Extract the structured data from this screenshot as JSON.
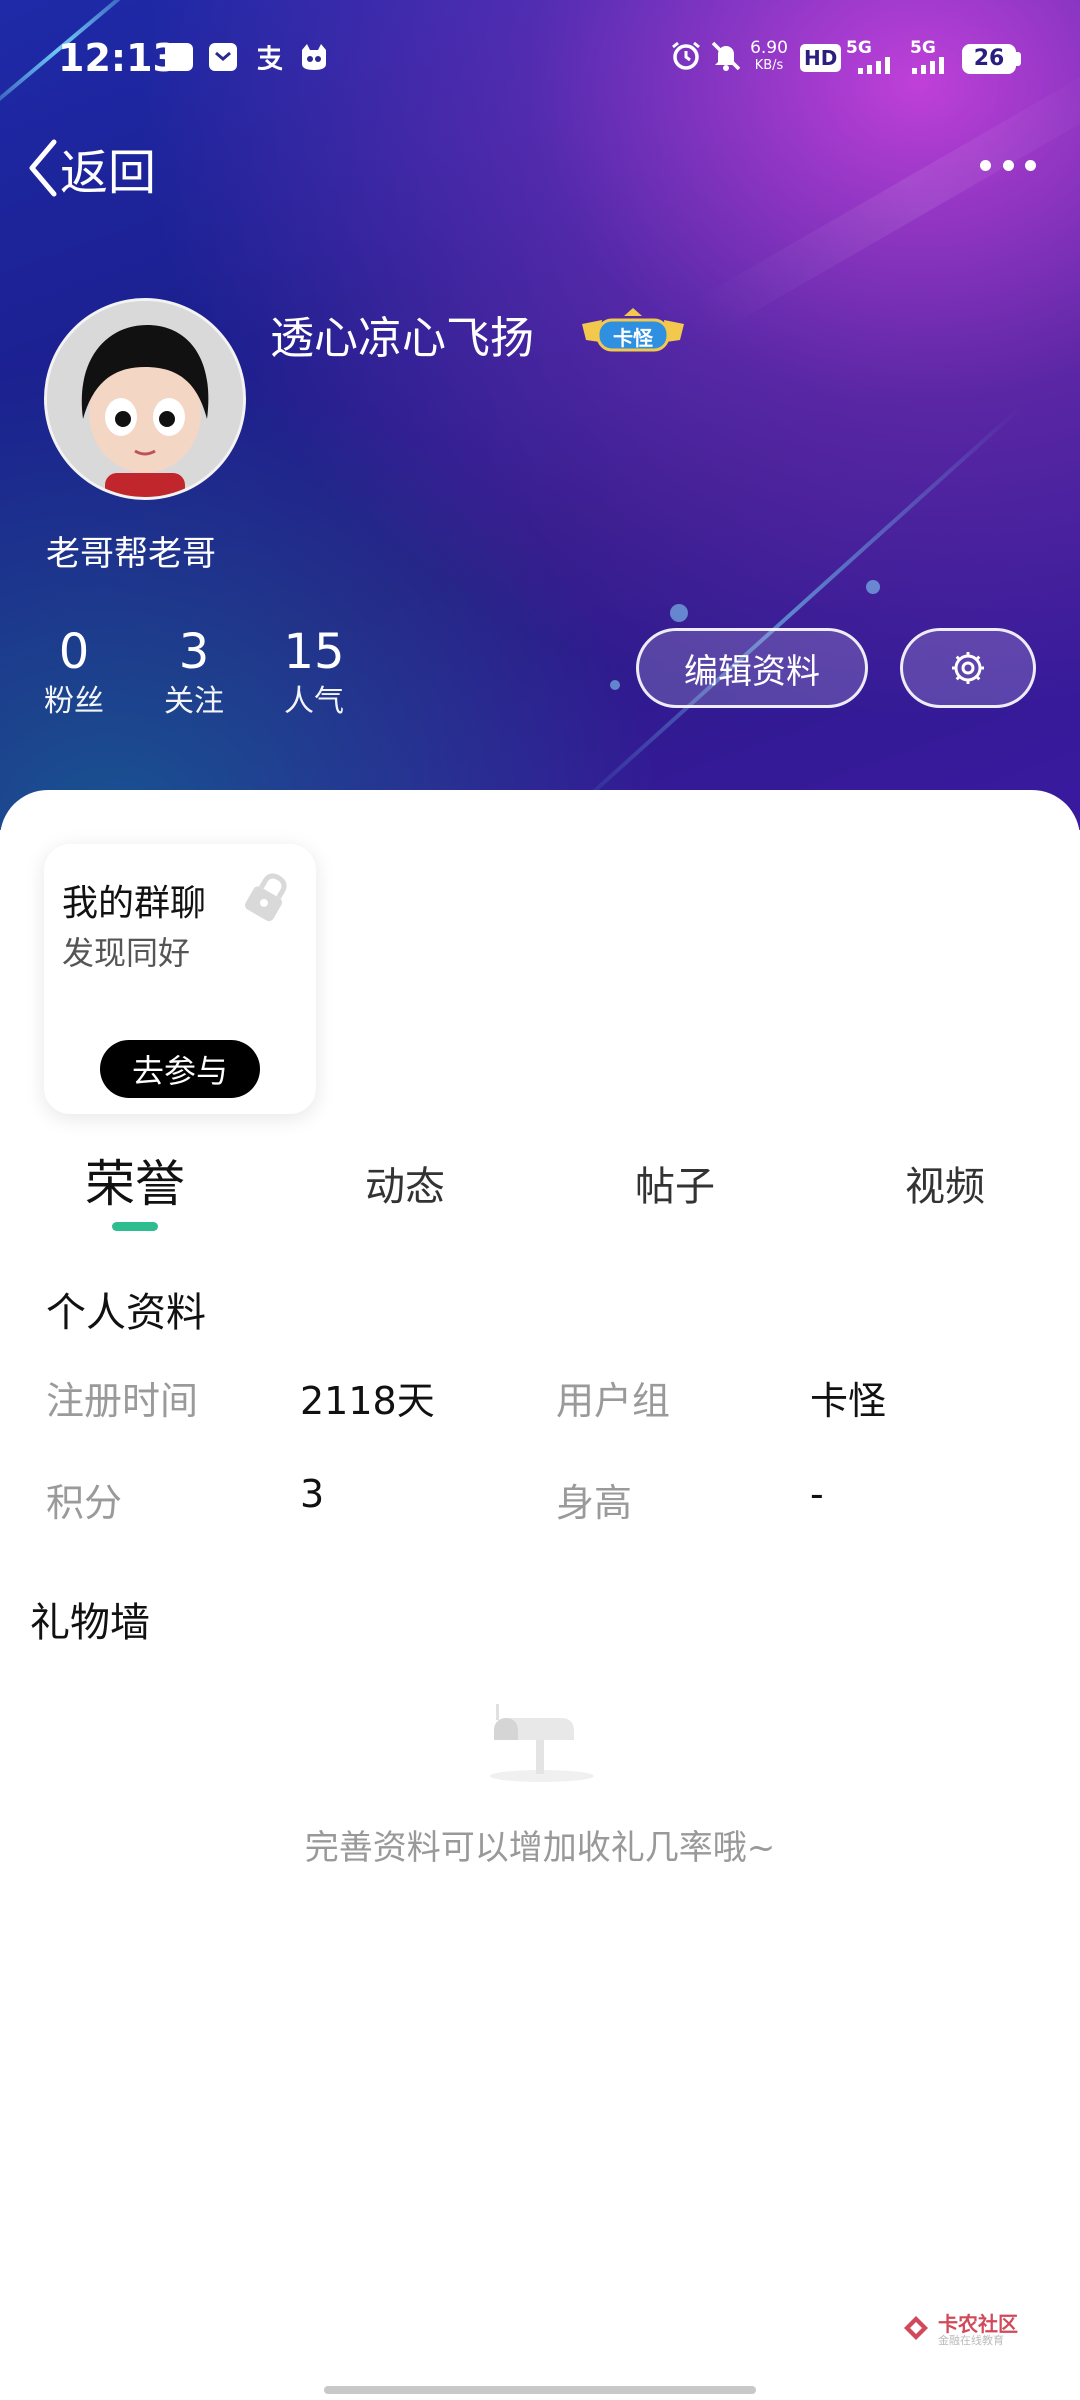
{
  "status_bar": {
    "time": "12:13",
    "speed_value": "6.90",
    "speed_unit": "KB/s",
    "hd": "HD",
    "sim1_label": "5G",
    "sim2_label": "5G",
    "battery": "26",
    "icons": [
      "app-notification-icon",
      "message-icon",
      "alipay-icon",
      "cat-app-icon",
      "alarm-icon",
      "mute-icon"
    ]
  },
  "nav": {
    "back_label": "返回",
    "more_icon": "more-dots-icon"
  },
  "profile": {
    "username": "透心凉心飞扬",
    "badge_text": "卡怪",
    "signature": "老哥帮老哥",
    "stats": [
      {
        "value": "0",
        "label": "粉丝"
      },
      {
        "value": "3",
        "label": "关注"
      },
      {
        "value": "15",
        "label": "人气"
      }
    ],
    "edit_button": "编辑资料",
    "settings_icon": "gear-icon"
  },
  "group_card": {
    "title": "我的群聊",
    "subtitle": "发现同好",
    "join_button": "去参与"
  },
  "tabs": [
    {
      "label": "荣誉",
      "active": true
    },
    {
      "label": "动态",
      "active": false
    },
    {
      "label": "帖子",
      "active": false
    },
    {
      "label": "视频",
      "active": false
    }
  ],
  "personal_info": {
    "title": "个人资料",
    "rows": [
      {
        "label": "注册时间",
        "value": "2118天",
        "label2": "用户组",
        "value2": "卡怪"
      },
      {
        "label": "积分",
        "value": "3",
        "label2": "身高",
        "value2": "-"
      }
    ]
  },
  "gift_wall": {
    "title": "礼物墙",
    "empty_text": "完善资料可以增加收礼几率哦~"
  },
  "watermark": {
    "name": "卡农社区",
    "sub": "金融在线教育"
  },
  "colors": {
    "accent": "#2ebd8f",
    "hero_start": "#1e2aa8",
    "hero_end": "#3a1aa0"
  }
}
